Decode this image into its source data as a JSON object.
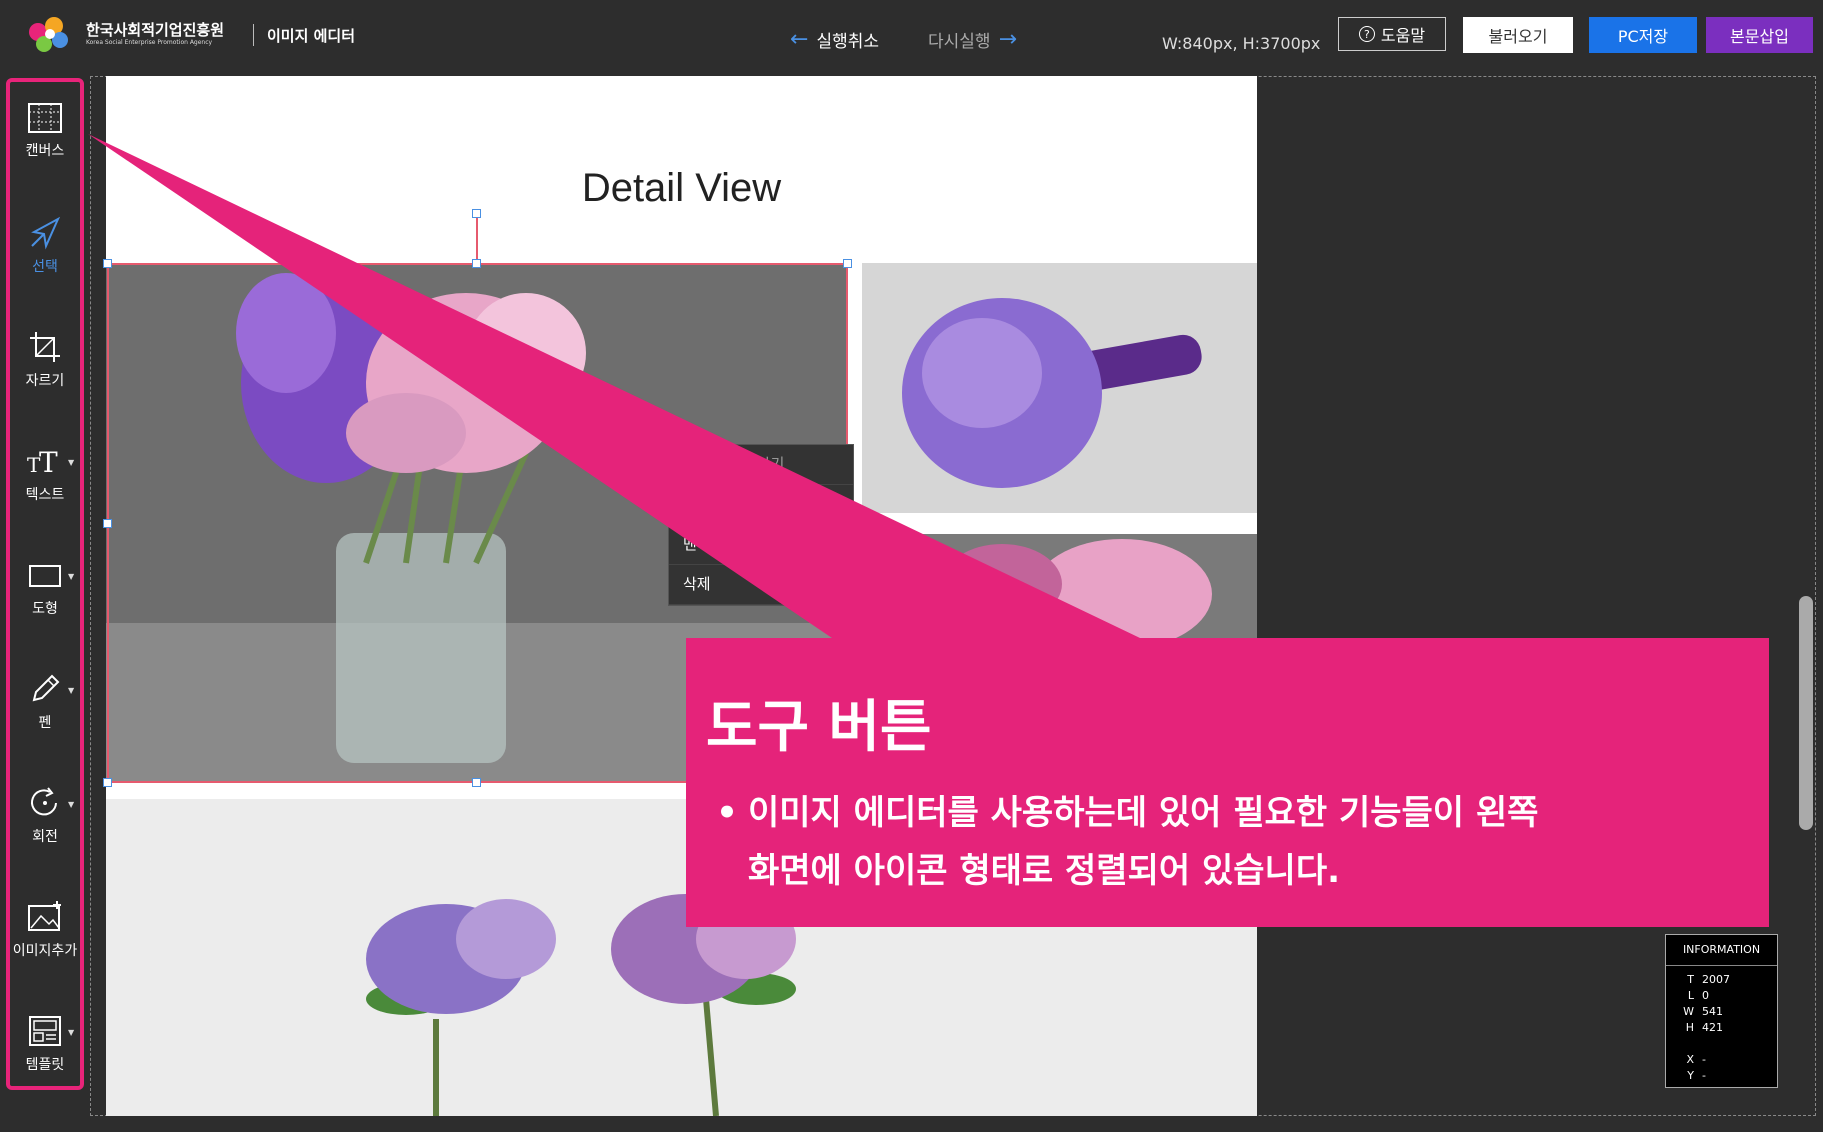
{
  "header": {
    "org_name_ko": "한국사회적기업진흥원",
    "org_name_en": "Korea Social Enterprise Promotion Agency",
    "app_title": "이미지 에디터",
    "undo_label": "실행취소",
    "redo_label": "다시실행",
    "canvas_dims": "W:840px, H:3700px",
    "help_label": "도움말",
    "load_label": "불러오기",
    "save_label": "PC저장",
    "insert_label": "본문삽입"
  },
  "sidebar": {
    "tools": [
      {
        "label": "캔버스",
        "icon": "canvas-grid-icon"
      },
      {
        "label": "선택",
        "icon": "select-cursor-icon",
        "active": true
      },
      {
        "label": "자르기",
        "icon": "crop-icon"
      },
      {
        "label": "텍스트",
        "icon": "text-icon"
      },
      {
        "label": "도형",
        "icon": "shape-rect-icon"
      },
      {
        "label": "펜",
        "icon": "pen-icon"
      },
      {
        "label": "회전",
        "icon": "rotate-icon"
      },
      {
        "label": "이미지추가",
        "icon": "add-image-icon"
      },
      {
        "label": "템플릿",
        "icon": "template-icon"
      }
    ]
  },
  "canvas": {
    "title": "Detail View"
  },
  "context_menu": {
    "items": [
      "이미지 교체하기",
      "맨 앞으로 가져오기",
      "맨 뒤로 보내기",
      "삭제"
    ]
  },
  "info_panel": {
    "title": "INFORMATION",
    "rows": [
      {
        "k": "T",
        "v": "2007"
      },
      {
        "k": "L",
        "v": "0"
      },
      {
        "k": "W",
        "v": "541"
      },
      {
        "k": "H",
        "v": "421"
      },
      {
        "k": "",
        "v": ""
      },
      {
        "k": "X",
        "v": "-"
      },
      {
        "k": "Y",
        "v": "-"
      }
    ]
  },
  "callout": {
    "title": "도구 버튼",
    "bullet": "•",
    "line1": "이미지 에디터를 사용하는데 있어 필요한 기능들이 왼쪽",
    "line2": "화면에 아이콘 형태로 정렬되어 있습니다."
  },
  "colors": {
    "accent_pink": "#e5237a",
    "save_blue": "#1a73e8",
    "insert_purple": "#7b2fbf"
  }
}
